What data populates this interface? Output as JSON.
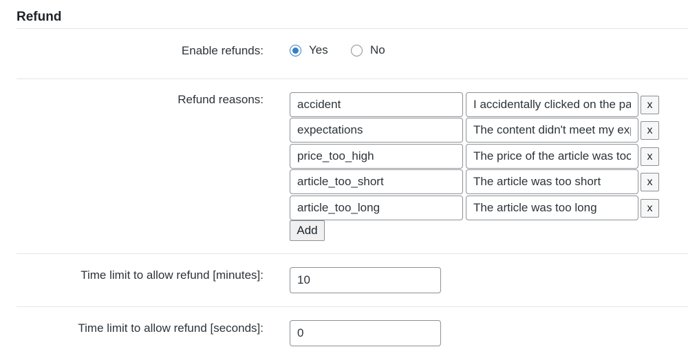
{
  "section": {
    "title": "Refund"
  },
  "enable_refunds": {
    "label": "Enable refunds:",
    "options": [
      {
        "label": "Yes",
        "checked": true
      },
      {
        "label": "No",
        "checked": false
      }
    ]
  },
  "refund_reasons": {
    "label": "Refund reasons:",
    "rows": [
      {
        "key": "accident",
        "value": "I accidentally clicked on the page",
        "remove_label": "x"
      },
      {
        "key": "expectations",
        "value": "The content didn't meet my expectations",
        "remove_label": "x"
      },
      {
        "key": "price_too_high",
        "value": "The price of the article was too high",
        "remove_label": "x"
      },
      {
        "key": "article_too_short",
        "value": "The article was too short",
        "remove_label": "x"
      },
      {
        "key": "article_too_long",
        "value": "The article was too long",
        "remove_label": "x"
      }
    ],
    "add_label": "Add"
  },
  "time_limit_minutes": {
    "label": "Time limit to allow refund [minutes]:",
    "value": "10"
  },
  "time_limit_seconds": {
    "label": "Time limit to allow refund [seconds]:",
    "value": "0"
  },
  "colors": {
    "accent": "#3582c4",
    "border": "#8c8f94",
    "divider": "#e5e5e5"
  }
}
